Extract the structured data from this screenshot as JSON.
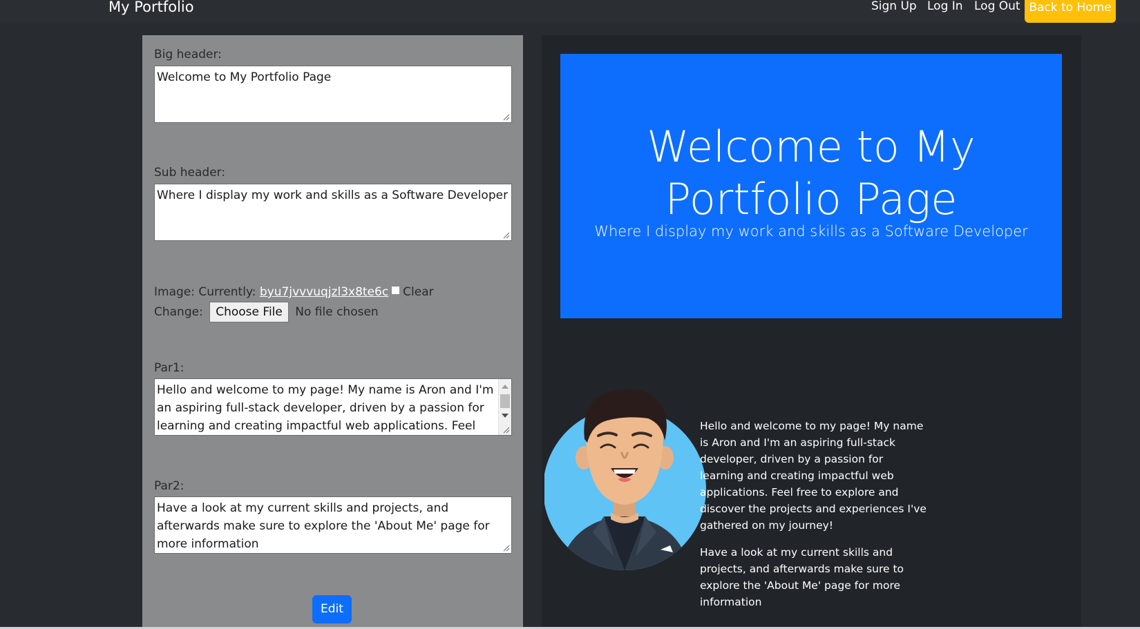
{
  "navbar": {
    "brand": "My Portfolio",
    "links": [
      "Sign Up",
      "Log In",
      "Log Out"
    ],
    "home_button": "Back to Home"
  },
  "form": {
    "big_header_label": "Big header:",
    "big_header_value": "Welcome to My Portfolio Page",
    "sub_header_label": "Sub header:",
    "sub_header_value": "Where I display my work and skills as a Software Developer",
    "image_label": "Image: Currently:",
    "image_file": "byu7jvvvuqjzl3x8te6c",
    "clear_label": "Clear",
    "change_label": "Change:",
    "choose_file": "Choose File",
    "no_file": "No file chosen",
    "par1_label": "Par1:",
    "par1_value": "Hello and welcome to my page! My name is Aron and I'm an aspiring full-stack developer, driven by a passion for learning and creating impactful web applications. Feel free to explore and discover the projects and experiences I've gathered on my journey!",
    "par2_label": "Par2:",
    "par2_value": "Have a look at my current skills and projects, and afterwards make sure to explore the 'About Me' page for more information",
    "edit_button": "Edit"
  },
  "preview": {
    "hero_title": "Welcome to My Portfolio Page",
    "hero_subtitle": "Where I display my work and skills as a Software Developer",
    "par1": "Hello and welcome to my page! My name is Aron and I'm an aspiring full-stack developer, driven by a passion for learning and creating impactful web applications. Feel free to explore and discover the projects and experiences I've gathered on my journey!",
    "par2": "Have a look at my current skills and projects, and afterwards make sure to explore the 'About Me' page for more information"
  },
  "colors": {
    "page_bg": "#282b30",
    "form_panel_bg": "#8a8b8d",
    "preview_bg": "#212429",
    "hero_blue": "#0d6efd",
    "home_button_yellow": "#ffc107",
    "edit_button_blue": "#0d6efd"
  },
  "icons": {
    "avatar": "smiling-man-avatar-icon",
    "resize": "resize-grip-icon"
  }
}
